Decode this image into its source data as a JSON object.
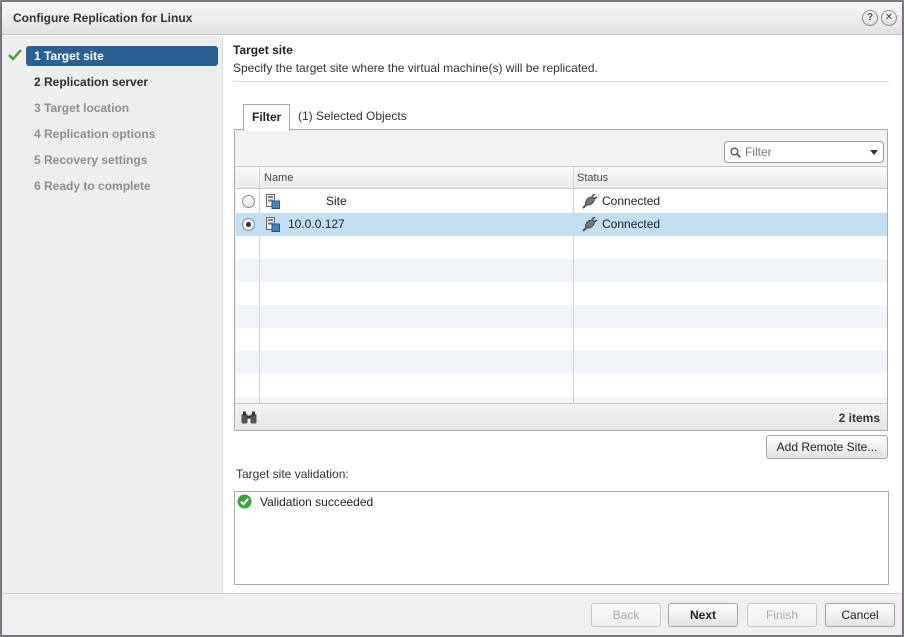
{
  "dialog": {
    "title": "Configure Replication for Linux",
    "help_label": "?",
    "close_label": "✕"
  },
  "steps": [
    {
      "label": "1  Target site",
      "state": "active"
    },
    {
      "label": "2  Replication server",
      "state": "enabled"
    },
    {
      "label": "3  Target location",
      "state": "disabled"
    },
    {
      "label": "4  Replication options",
      "state": "disabled"
    },
    {
      "label": "5  Recovery settings",
      "state": "disabled"
    },
    {
      "label": "6  Ready to complete",
      "state": "disabled"
    }
  ],
  "content": {
    "title": "Target site",
    "description": "Specify the target site where the virtual machine(s) will be replicated.",
    "tabs": [
      {
        "label": "Filter",
        "active": true
      },
      {
        "label": "(1) Selected Objects",
        "active": false
      }
    ],
    "filter": {
      "placeholder": "Filter"
    },
    "grid": {
      "columns": [
        "Name",
        "Status"
      ],
      "rows": [
        {
          "name": "Site",
          "status": "Connected",
          "selected": false
        },
        {
          "name": "10.0.0.127",
          "status": "Connected",
          "selected": true
        }
      ],
      "footer_count": "2 items"
    },
    "add_remote_site_label": "Add Remote Site...",
    "validation": {
      "label": "Target site validation:",
      "message": "Validation succeeded"
    }
  },
  "footer": {
    "back": "Back",
    "next": "Next",
    "finish": "Finish",
    "cancel": "Cancel"
  },
  "colors": {
    "active_step": "#2c6094",
    "selected_row": "#c3dff4",
    "success_green": "#3aa63a",
    "check_green": "#4b9a2f"
  },
  "icons": {
    "completed_step": "checkmark-icon",
    "help": "help-icon",
    "close": "close-icon",
    "search": "search-icon",
    "dropdown": "chevron-down-icon",
    "site": "site-icon",
    "status": "connected-plug-icon",
    "find": "binoculars-icon",
    "validation": "success-icon"
  }
}
